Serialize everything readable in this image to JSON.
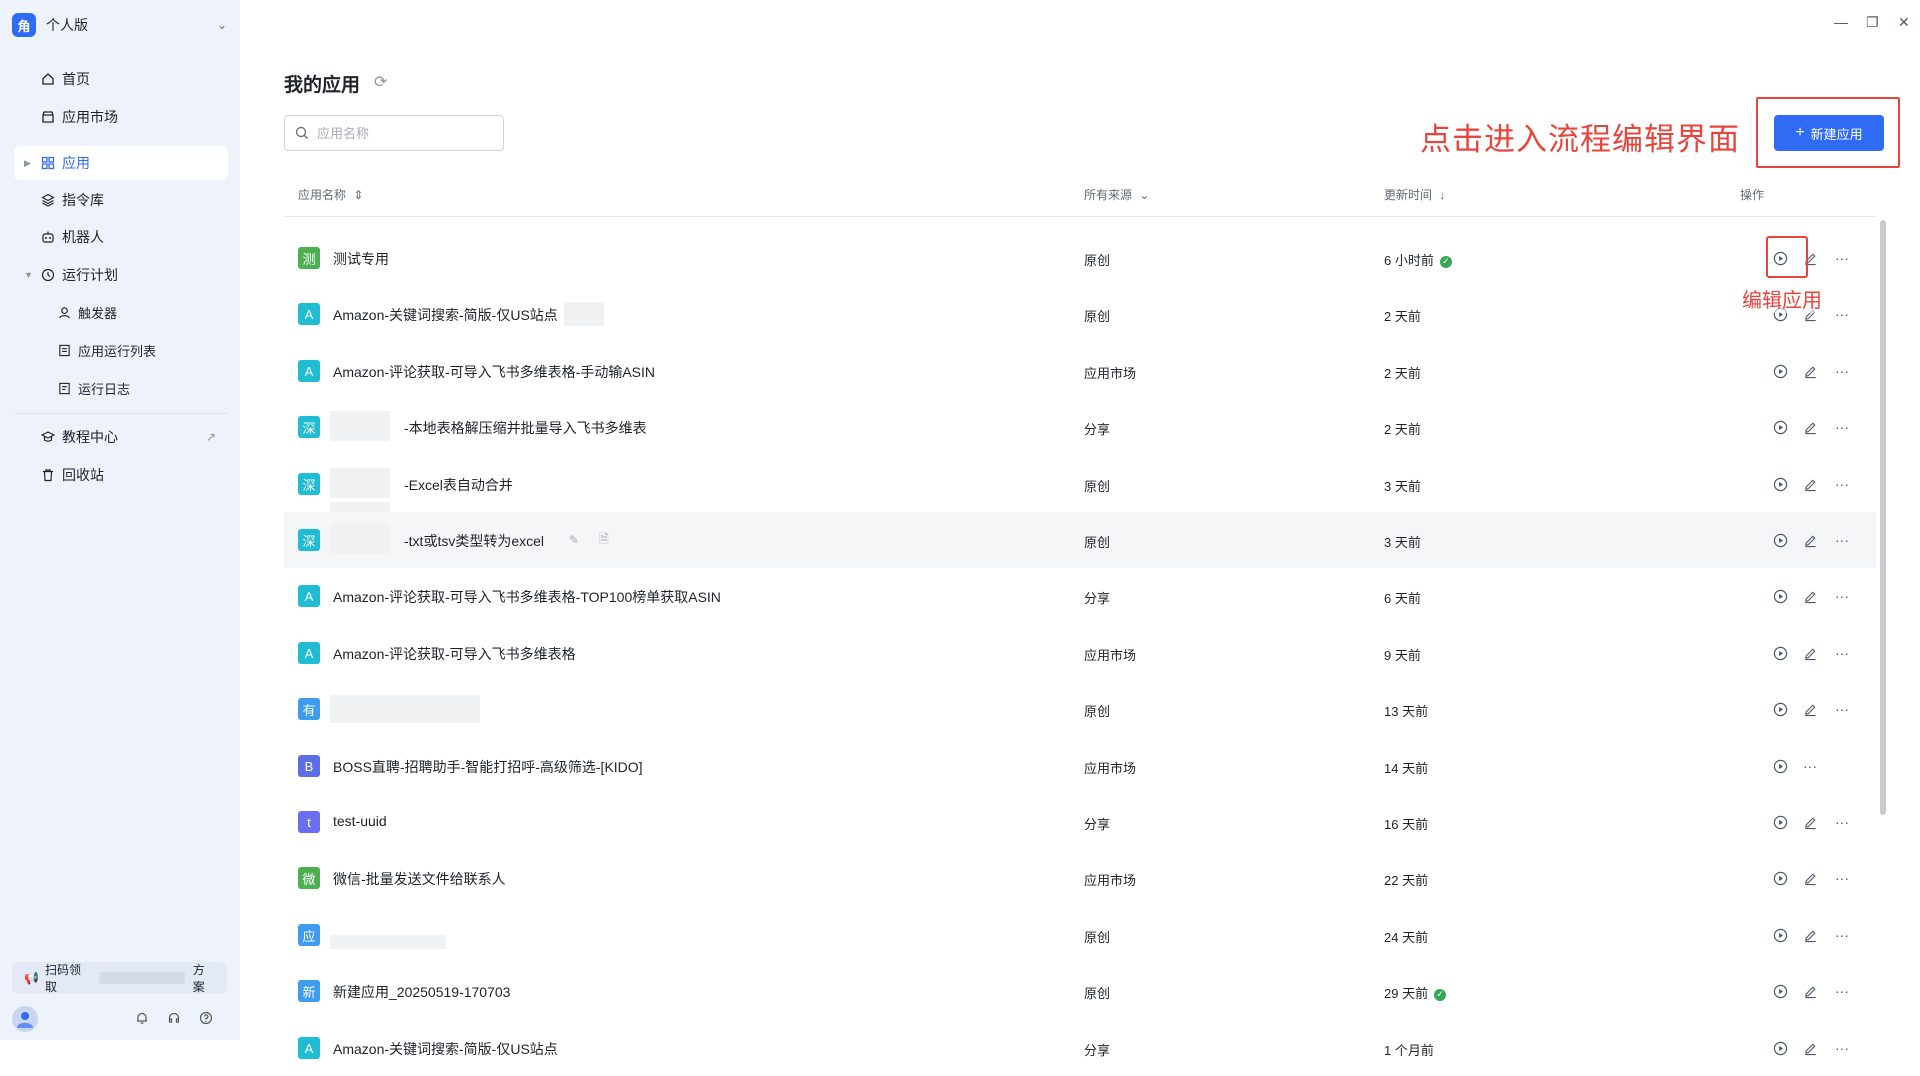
{
  "window": {
    "minimize_icon": "minimize-icon",
    "restore_icon": "restore-icon",
    "close_icon": "close-icon"
  },
  "sidebar": {
    "workspace": {
      "logo": "角",
      "name": "个人版"
    },
    "nav": [
      {
        "label": "首页",
        "icon": "home-icon"
      },
      {
        "label": "应用市场",
        "icon": "market-icon"
      },
      {
        "label": "应用",
        "icon": "apps-icon",
        "active": true
      },
      {
        "label": "指令库",
        "icon": "layers-icon"
      },
      {
        "label": "机器人",
        "icon": "robot-icon"
      },
      {
        "label": "运行计划",
        "icon": "clock-icon"
      },
      {
        "label": "触发器",
        "icon": "trigger-icon"
      },
      {
        "label": "应用运行列表",
        "icon": "list-icon"
      },
      {
        "label": "运行日志",
        "icon": "log-icon"
      },
      {
        "label": "教程中心",
        "icon": "tutorial-icon"
      },
      {
        "label": "回收站",
        "icon": "trash-icon"
      }
    ],
    "promo": {
      "label": "扫码领取",
      "suffix": "方案"
    }
  },
  "main": {
    "title": "我的应用",
    "search_placeholder": "应用名称",
    "new_button": "新建应用",
    "annotation_new": "点击进入流程编辑界面",
    "annotation_edit": "编辑应用",
    "columns": {
      "name": "应用名称",
      "source": "所有来源",
      "updated": "更新时间",
      "actions": "操作"
    },
    "rows": [
      {
        "icon_text": "测",
        "icon_color": "#4cb050",
        "name": "测试专用",
        "source": "原创",
        "time": "6 小时前",
        "check": true
      },
      {
        "icon_text": "A",
        "icon_color": "#1fbcd3",
        "name": "Amazon-关键词搜索-简版-仅US站点",
        "source": "原创",
        "time": "2 天前"
      },
      {
        "icon_text": "A",
        "icon_color": "#1fbcd3",
        "name": "Amazon-评论获取-可导入飞书多维表格-手动输ASIN",
        "source": "应用市场",
        "time": "2 天前"
      },
      {
        "icon_text": "深",
        "icon_color": "#1fbcd3",
        "name": "-本地表格解压缩并批量导入飞书多维表",
        "source": "分享",
        "time": "2 天前"
      },
      {
        "icon_text": "深",
        "icon_color": "#1fbcd3",
        "name": "-Excel表自动合并",
        "source": "原创",
        "time": "3 天前"
      },
      {
        "icon_text": "深",
        "icon_color": "#1fbcd3",
        "name": "-txt或tsv类型转为excel",
        "source": "原创",
        "time": "3 天前"
      },
      {
        "icon_text": "A",
        "icon_color": "#1fbcd3",
        "name": "Amazon-评论获取-可导入飞书多维表格-TOP100榜单获取ASIN",
        "source": "分享",
        "time": "6 天前"
      },
      {
        "icon_text": "A",
        "icon_color": "#1fbcd3",
        "name": "Amazon-评论获取-可导入飞书多维表格",
        "source": "应用市场",
        "time": "9 天前"
      },
      {
        "icon_text": "有",
        "icon_color": "#3d9bf0",
        "name": "",
        "source": "原创",
        "time": "13 天前"
      },
      {
        "icon_text": "B",
        "icon_color": "#5b6ee8",
        "name": "BOSS直聘-招聘助手-智能打招呼-高级筛选-[KIDO]",
        "source": "应用市场",
        "time": "14 天前"
      },
      {
        "icon_text": "t",
        "icon_color": "#6a6ef0",
        "name": "test-uuid",
        "source": "分享",
        "time": "16 天前"
      },
      {
        "icon_text": "微",
        "icon_color": "#4cb050",
        "name": "微信-批量发送文件给联系人",
        "source": "应用市场",
        "time": "22 天前"
      },
      {
        "icon_text": "应",
        "icon_color": "#3d9bf0",
        "name": "",
        "source": "原创",
        "time": "24 天前"
      },
      {
        "icon_text": "新",
        "icon_color": "#3d9bf0",
        "name": "新建应用_20250519-170703",
        "source": "原创",
        "time": "29 天前",
        "check": true
      },
      {
        "icon_text": "A",
        "icon_color": "#1fbcd3",
        "name": "Amazon-关键词搜索-简版-仅US站点",
        "source": "分享",
        "time": "1 个月前"
      }
    ]
  }
}
